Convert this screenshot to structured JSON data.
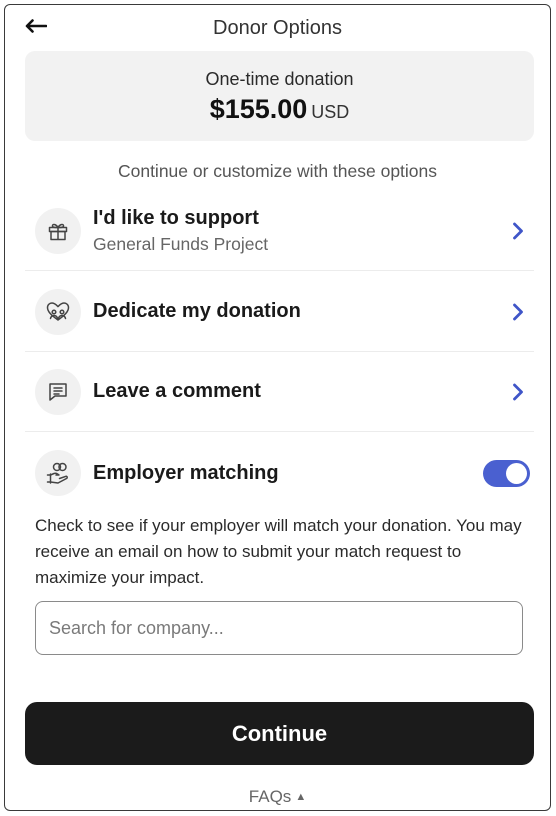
{
  "header": {
    "title": "Donor Options",
    "back_icon": "arrow-left-icon"
  },
  "summary": {
    "type": "One-time donation",
    "amount": "$155.00",
    "currency": "USD"
  },
  "subtitle": "Continue or customize with these options",
  "options": [
    {
      "title": "I'd like to support",
      "subtitle": "General Funds Project",
      "icon": "gift-icon"
    },
    {
      "title": "Dedicate my donation",
      "icon": "heart-people-icon"
    },
    {
      "title": "Leave a comment",
      "icon": "comment-icon"
    }
  ],
  "employer_matching": {
    "title": "Employer matching",
    "icon": "hand-coins-icon",
    "enabled": true,
    "description": "Check to see if your employer will match your donation. You may receive an email on how to submit your match request to maximize your impact.",
    "search_placeholder": "Search for company...",
    "search_value": ""
  },
  "continue_label": "Continue",
  "faqs_label": "FAQs",
  "colors": {
    "accent": "#4a60d0",
    "button": "#1b1b1b",
    "card_bg": "#f2f2f2"
  }
}
